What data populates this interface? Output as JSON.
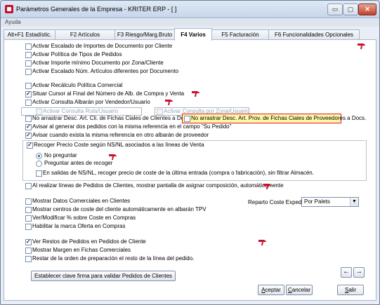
{
  "window": {
    "title": "Parámetros Generales de la Empresa - KRITER ERP - [            ]",
    "controls": {
      "minimize": "▭",
      "maximize": "▢",
      "close": "✕"
    }
  },
  "menu": {
    "ayuda": "Ayuda"
  },
  "tabs": [
    {
      "label": "Alt+F1 Estadístic."
    },
    {
      "label": "F2 Artículos"
    },
    {
      "label": "F3 Riesgo/Marg.Bruto"
    },
    {
      "label": "F4 Varios"
    },
    {
      "label": "F5 Facturación"
    },
    {
      "label": "F6 Funcionalidades Opcionales"
    }
  ],
  "options": {
    "o1": {
      "label": "Activar Escalado de Importes de Documento por Cliente",
      "checked": false
    },
    "o2": {
      "label": "Activar Política de Tipos de Pedidos",
      "checked": false
    },
    "o3": {
      "label": "Activar Importe mínimo Documento por Zona/Cliente",
      "checked": false
    },
    "o4": {
      "label": "Activar Escalado Núm. Artículos diferentes por Documento",
      "checked": false
    },
    "o5": {
      "label": "Activar Recálculo Política Comercial",
      "checked": false
    },
    "o6": {
      "label": "Situar Cursor al Final del Número de Alb. de Compra y Venta",
      "checked": true
    },
    "o7": {
      "label": "Activar Consulta Albarán por Vendedor/Usuario",
      "checked": false
    },
    "o7a": {
      "label": "Activar Consulta Ruta/Usuario",
      "checked": false
    },
    "o7b": {
      "label": "Activar Consulta por Zona/Usuario",
      "checked": false
    },
    "o8": {
      "label": "No arrastrar Desc. Art. Cli. de Fichas Ciales de Clientes a Docs.",
      "checked": false
    },
    "o8b": {
      "label": "No arrastrar Desc. Art. Prov. de Fichas Ciales de Proveedores a Docs.",
      "checked": false
    },
    "o9": {
      "label": "Avisar al generar dos pedidos con la misma referencia en el campo \"Su Pedido\"",
      "checked": true
    },
    "o10": {
      "label": "Avisar cuando exista la misma referencia en otro albarán de proveedor",
      "checked": true
    },
    "o11": {
      "label": "Recoger Precio Coste según NS/NL asociados a las líneas de Venta",
      "checked": true
    },
    "r1": {
      "label": "No preguntar",
      "selected": true
    },
    "r2": {
      "label": "Preguntar antes de recoger",
      "selected": false
    },
    "o12": {
      "label": "En salidas de NS/NL, recoger precio de coste de la última entrada (compra o fabricación), sin filtrar Almacén.",
      "checked": false
    },
    "o13": {
      "label": "Al realizar líneas de Pedidos de Clientes, mostrar pantalla de asignar composición, automáticamente",
      "checked": false
    },
    "o14": {
      "label": "Mostrar Datos Comerciales en Clientes",
      "checked": false
    },
    "o15": {
      "label": "Mostrar centros de coste del cliente automáticamente en albarán TPV",
      "checked": false
    },
    "o16": {
      "label": "Ver/Modificar % sobre Coste en Compras",
      "checked": false
    },
    "o17": {
      "label": "Habilitar la marca Oferta en Compras",
      "checked": false
    },
    "o18": {
      "label": "Ver Restos de Pedidos en Pedidos de Cliente",
      "checked": true
    },
    "o19": {
      "label": "Mostrar Margen en Fichas Comerciales",
      "checked": false
    },
    "o20": {
      "label": "Restar de la orden de preparación el resto de la línea del pedido.",
      "checked": false
    }
  },
  "reparto": {
    "label": "Reparto Coste Exped.",
    "value": "Por Palets"
  },
  "buttons": {
    "clave": "Establecer clave firma para validar Pedidos de Clientes",
    "aceptar_u": "A",
    "aceptar_rest": "ceptar",
    "cancelar_u": "C",
    "cancelar_rest": "ancelar",
    "salir_u": "S",
    "salir_rest": "alir",
    "prev": "←",
    "next": "→"
  },
  "colors": {
    "help_icon": "#c8102e",
    "highlight_bg": "#fff8a8",
    "highlight_border": "#d81a1a"
  }
}
